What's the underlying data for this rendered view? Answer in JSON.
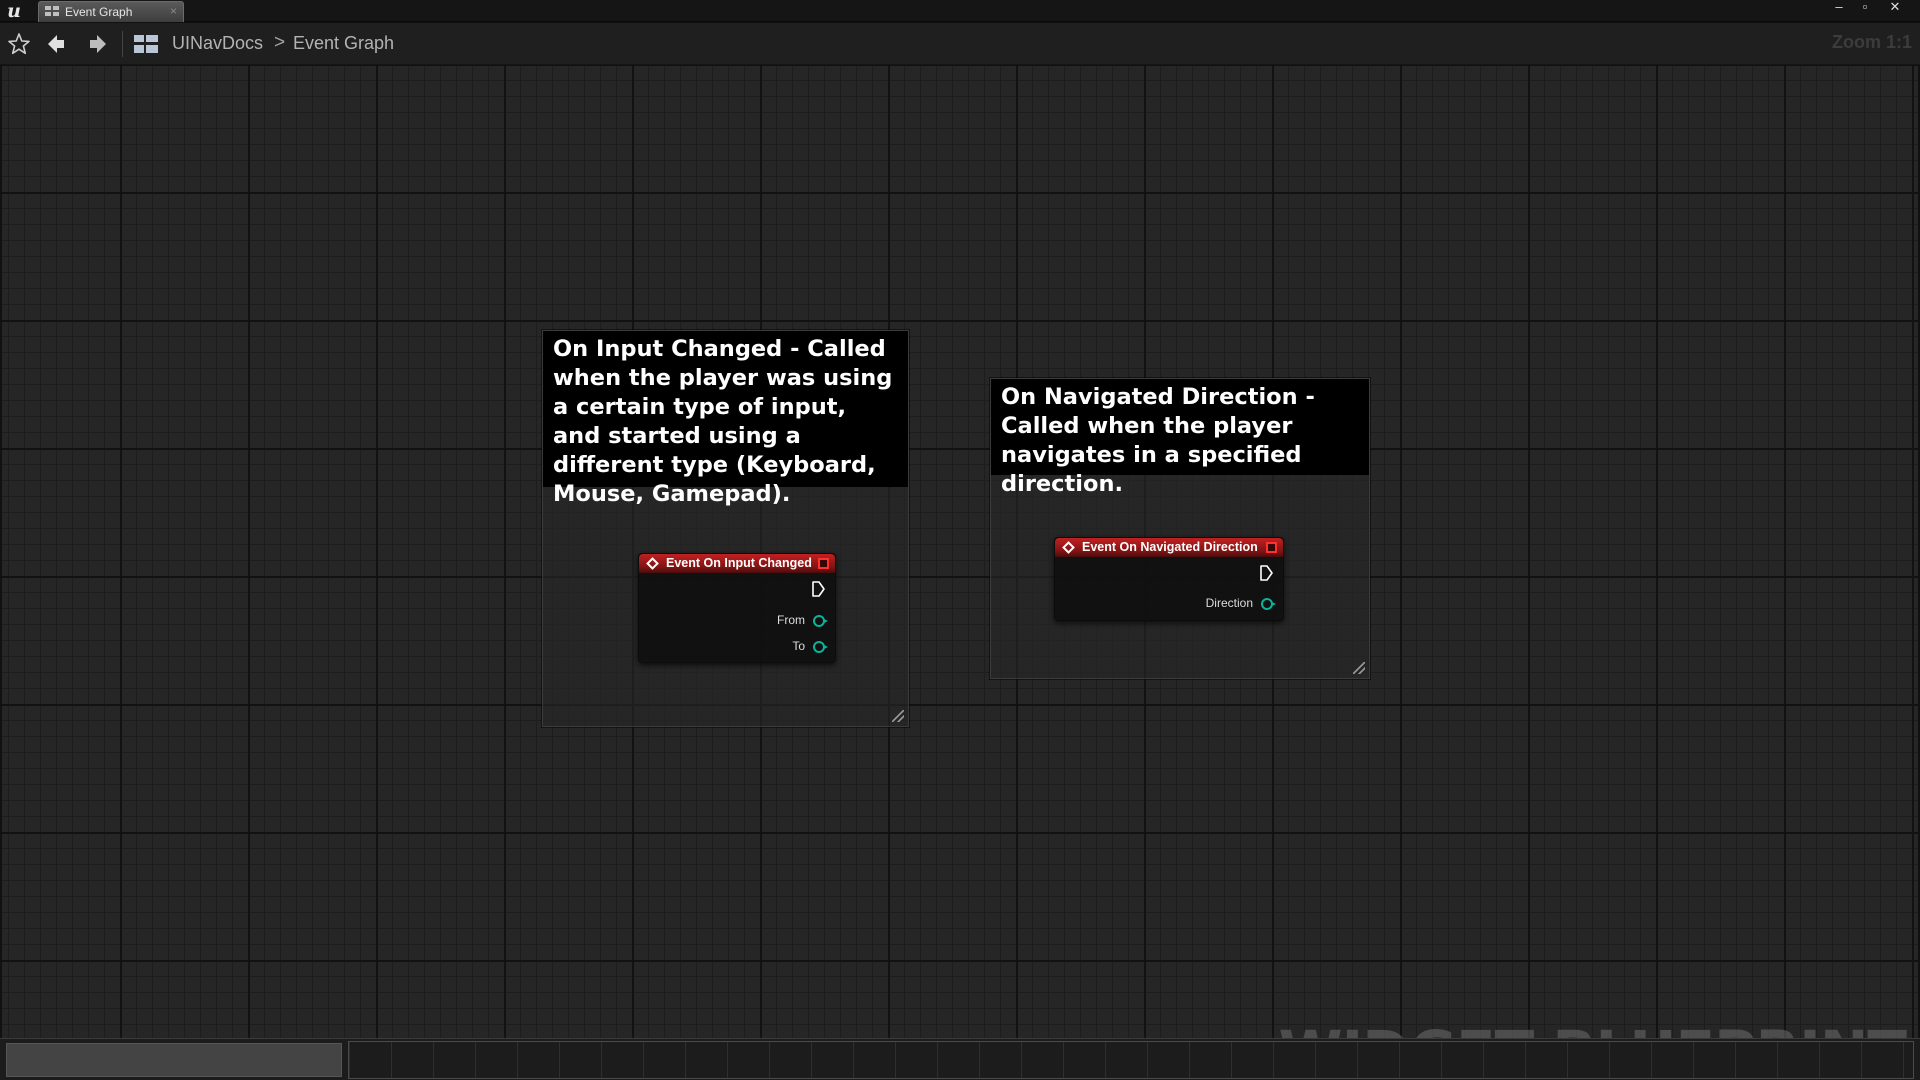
{
  "window": {
    "tab_label": "Event Graph",
    "tab_close": "×",
    "controls": [
      "–",
      "▫",
      "✕"
    ]
  },
  "toolbar": {
    "breadcrumb": [
      "UINavDocs",
      "Event Graph"
    ],
    "breadcrumb_separator": ">",
    "zoom": "Zoom 1:1"
  },
  "graph": {
    "comments": [
      {
        "text": "On Input Changed - Called when the player was using a certain type of input, and started using a different type (Keyboard, Mouse, Gamepad).",
        "node": {
          "title": "Event On Input Changed",
          "pins": [
            "From",
            "To"
          ]
        }
      },
      {
        "text": "On Navigated Direction - Called when the player navigates in a specified direction.",
        "node": {
          "title": "Event On Navigated Direction",
          "pins": [
            "Direction"
          ]
        }
      }
    ],
    "watermark": "WIDGET BLUEPRINT"
  },
  "colors": {
    "event_header": "#c22020",
    "data_pin": "#0bb39a",
    "delegate_pin": "#ff3030"
  }
}
